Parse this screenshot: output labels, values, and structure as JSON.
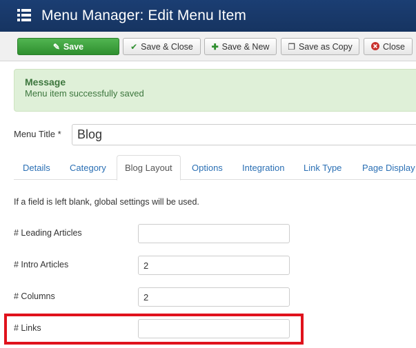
{
  "header": {
    "title": "Menu Manager: Edit Menu Item",
    "icon": "list-menu-icon"
  },
  "toolbar": {
    "save": "Save",
    "save_close": "Save & Close",
    "save_new": "Save & New",
    "save_copy": "Save as Copy",
    "close": "Close"
  },
  "alert": {
    "heading": "Message",
    "text": "Menu item successfully saved"
  },
  "title_field": {
    "label": "Menu Title *",
    "value": "Blog"
  },
  "tabs": [
    {
      "label": "Details"
    },
    {
      "label": "Category"
    },
    {
      "label": "Blog Layout",
      "active": true
    },
    {
      "label": "Options"
    },
    {
      "label": "Integration"
    },
    {
      "label": "Link Type"
    },
    {
      "label": "Page Display"
    }
  ],
  "note": "If a field is left blank, global settings will be used.",
  "fields": [
    {
      "label": "# Leading Articles",
      "value": ""
    },
    {
      "label": "# Intro Articles",
      "value": "2"
    },
    {
      "label": "# Columns",
      "value": "2"
    },
    {
      "label": "# Links",
      "value": "",
      "highlighted": true
    }
  ],
  "colors": {
    "header": "#1b3e73",
    "save": "#3fa33f",
    "alert_bg": "#dff0d8",
    "alert_text": "#3c763d",
    "link": "#2a6fb4",
    "highlight": "#e0121c"
  }
}
